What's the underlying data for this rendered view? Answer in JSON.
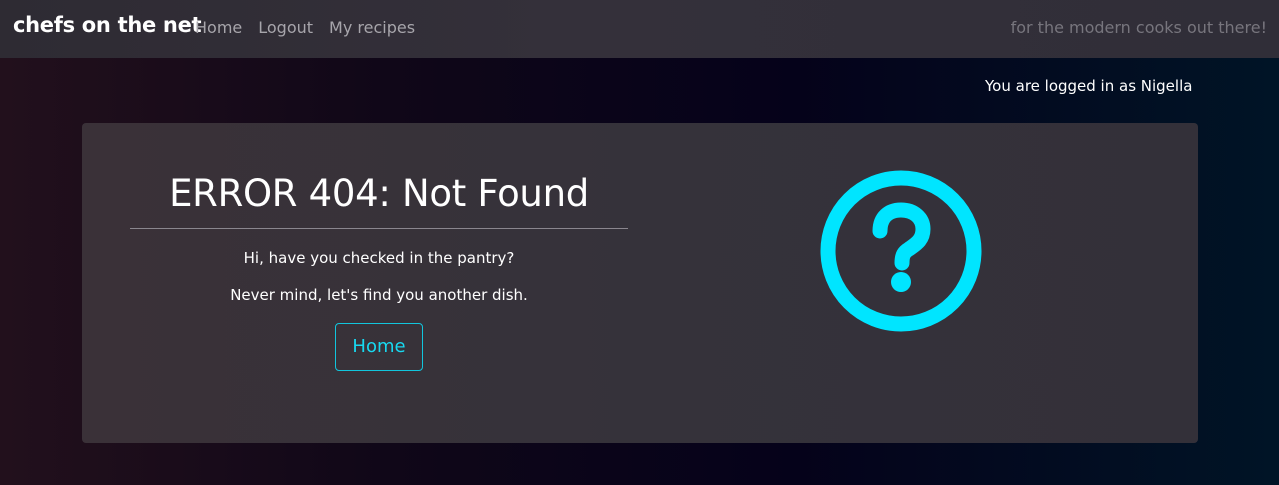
{
  "navbar": {
    "brand": "chefs on the net",
    "links": [
      "Home",
      "Logout",
      "My recipes"
    ],
    "tagline": "for the modern cooks out there!"
  },
  "user": {
    "status": "You are logged in as Nigella"
  },
  "error": {
    "title": "ERROR 404: Not Found",
    "message1": "Hi, have you checked in the pantry?",
    "message2": "Never mind, let's find you another dish.",
    "button_label": "Home",
    "icon": "question-circle-icon"
  },
  "colors": {
    "accent": "#00e5ff",
    "nav_bg": "#312e36",
    "card_bg": "#35323a"
  }
}
